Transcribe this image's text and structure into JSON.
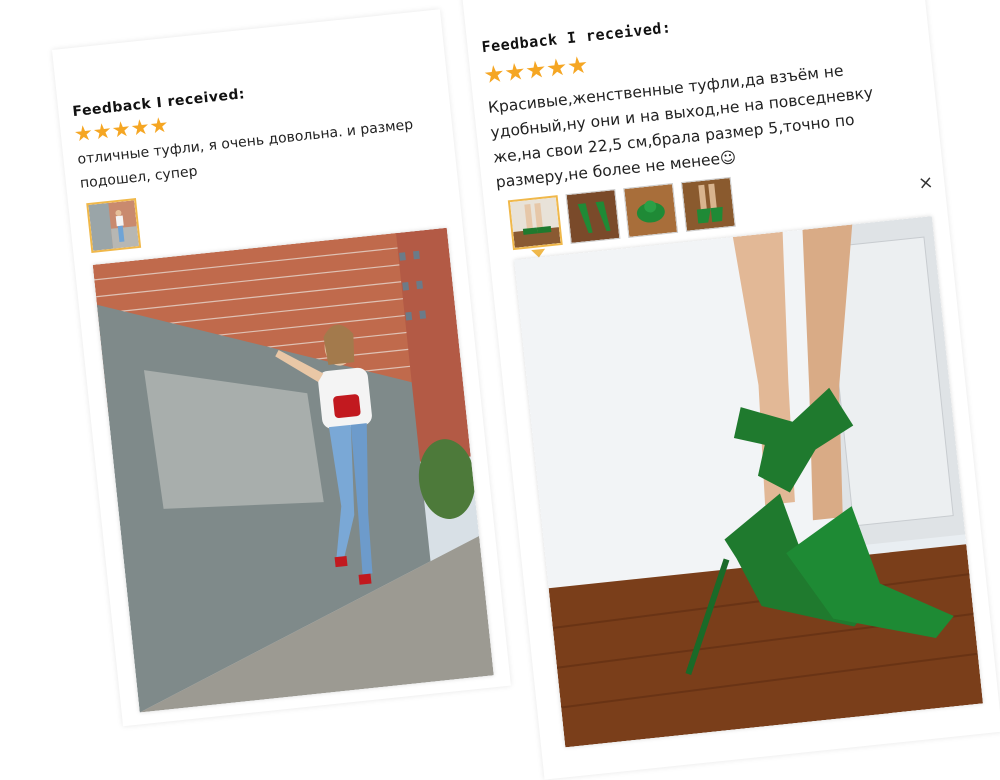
{
  "left_review": {
    "heading": "Feedback I received:",
    "stars": 5,
    "text": "отличные туфли, я очень довольна. и размер подошел, супер",
    "thumbnails": 1,
    "photo_alt": "Woman in white top and jeans with red heels and red bag posing by brick wall"
  },
  "right_review": {
    "heading": "Feedback I received:",
    "stars": 5,
    "text": "Красивые,женственные туфли,да взъём не удобный,ну они и на выход,не на повседневку же,на свои 22,5 см,брала размер 5,точно по размеру,не более не менее☺",
    "thumbnails": 4,
    "close_label": "×",
    "photo_alt": "Legs wearing green suede heels with large bow on wooden floor"
  },
  "colors": {
    "star": "#f5a623",
    "thumb_active_border": "#f0b84a"
  }
}
